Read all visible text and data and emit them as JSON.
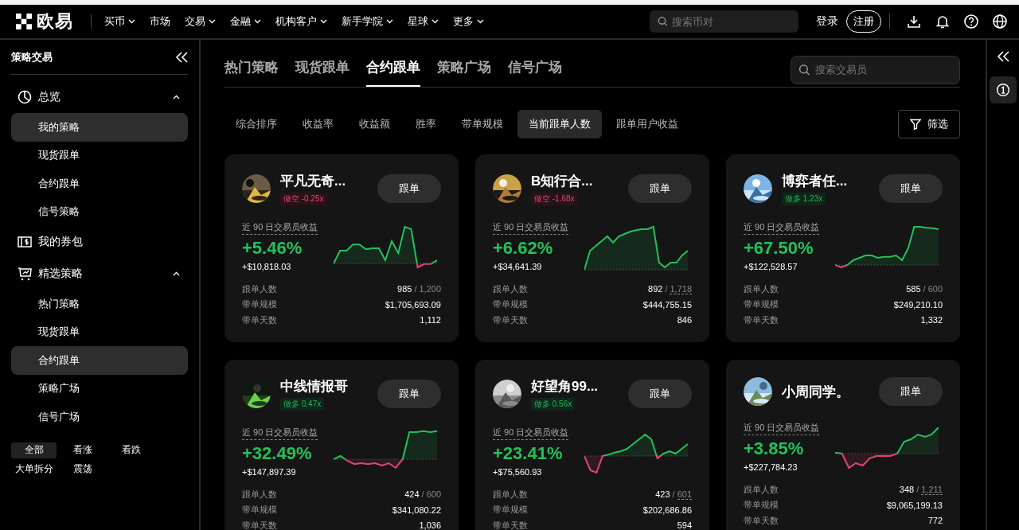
{
  "header": {
    "logo": "欧易",
    "menu": [
      {
        "label": "买币",
        "dropdown": true
      },
      {
        "label": "市场",
        "dropdown": false
      },
      {
        "label": "交易",
        "dropdown": true
      },
      {
        "label": "金融",
        "dropdown": true
      },
      {
        "label": "机构客户",
        "dropdown": true
      },
      {
        "label": "新手学院",
        "dropdown": true
      },
      {
        "label": "星球",
        "dropdown": true
      },
      {
        "label": "更多",
        "dropdown": true
      }
    ],
    "search": {
      "placeholder": "搜索币对"
    },
    "login": "登录",
    "register": "注册"
  },
  "sidebar": {
    "title": "策略交易",
    "groups": [
      {
        "label": "总览",
        "expanded": true,
        "children": [
          {
            "label": "我的策略",
            "selected": true
          },
          {
            "label": "现货跟单",
            "selected": false
          },
          {
            "label": "合约跟单",
            "selected": false
          },
          {
            "label": "信号策略",
            "selected": false
          }
        ]
      },
      {
        "label": "我的券包"
      },
      {
        "label": "精选策略",
        "expanded": true,
        "children": [
          {
            "label": "热门策略",
            "selected": false
          },
          {
            "label": "现货跟单",
            "selected": false
          },
          {
            "label": "合约跟单",
            "selected": true
          },
          {
            "label": "策略广场",
            "selected": false
          },
          {
            "label": "信号广场",
            "selected": false
          }
        ]
      }
    ],
    "filters": [
      {
        "label": "全部",
        "selected": true
      },
      {
        "label": "看涨",
        "selected": false
      },
      {
        "label": "看跌",
        "selected": false
      },
      {
        "label": "大单拆分",
        "selected": false
      },
      {
        "label": "震荡",
        "selected": false
      }
    ]
  },
  "main": {
    "tabs": [
      {
        "label": "热门策略",
        "selected": false
      },
      {
        "label": "现货跟单",
        "selected": false
      },
      {
        "label": "合约跟单",
        "selected": true
      },
      {
        "label": "策略广场",
        "selected": false
      },
      {
        "label": "信号广场",
        "selected": false
      }
    ],
    "search": {
      "placeholder": "搜索交易员"
    },
    "sort_options": [
      {
        "label": "综合排序",
        "selected": false
      },
      {
        "label": "收益率",
        "selected": false
      },
      {
        "label": "收益额",
        "selected": false
      },
      {
        "label": "胜率",
        "selected": false
      },
      {
        "label": "带单规模",
        "selected": false
      },
      {
        "label": "当前跟单人数",
        "selected": true
      },
      {
        "label": "跟单用户收益",
        "selected": false
      }
    ],
    "filter_button": "筛选",
    "cards": [
      {
        "name": "平凡无奇...",
        "tag": {
          "kind": "short",
          "text": "做空 -0.25x"
        },
        "button": "跟单",
        "metric_label": "近 90 日交易员收益",
        "roi": "+5.46%",
        "pnl": "+$10,818.03",
        "stats": [
          {
            "label": "跟单人数",
            "value": "985",
            "separator": "/",
            "max": "1,200",
            "max_underlined": false
          },
          {
            "label": "带单规模",
            "value": "$1,705,693.09"
          },
          {
            "label": "带单天数",
            "value": "1,112"
          }
        ]
      },
      {
        "name": "B知行合...",
        "tag": {
          "kind": "short",
          "text": "做空 -1.68x"
        },
        "button": "跟单",
        "metric_label": "近 90 日交易员收益",
        "roi": "+6.62%",
        "pnl": "+$34,641.39",
        "stats": [
          {
            "label": "跟单人数",
            "value": "892",
            "separator": "/",
            "max": "1,718",
            "max_underlined": true
          },
          {
            "label": "带单规模",
            "value": "$444,755.15"
          },
          {
            "label": "带单天数",
            "value": "846"
          }
        ]
      },
      {
        "name": "博弈者任...",
        "tag": {
          "kind": "long",
          "text": "做多 1.23x"
        },
        "button": "跟单",
        "metric_label": "近 90 日交易员收益",
        "roi": "+67.50%",
        "pnl": "+$122,528.57",
        "stats": [
          {
            "label": "跟单人数",
            "value": "585",
            "separator": "/",
            "max": "600",
            "max_underlined": false
          },
          {
            "label": "带单规模",
            "value": "$249,210.10"
          },
          {
            "label": "带单天数",
            "value": "1,332"
          }
        ]
      },
      {
        "name": "中线情报哥",
        "tag": {
          "kind": "long",
          "text": "做多 0.47x"
        },
        "button": "跟单",
        "metric_label": "近 90 日交易员收益",
        "roi": "+32.49%",
        "pnl": "+$147,897.39",
        "stats": [
          {
            "label": "跟单人数",
            "value": "424",
            "separator": "/",
            "max": "600",
            "max_underlined": false
          },
          {
            "label": "带单规模",
            "value": "$341,080.22"
          },
          {
            "label": "带单天数",
            "value": "1,036"
          }
        ]
      },
      {
        "name": "好望角99...",
        "tag": {
          "kind": "long",
          "text": "做多 0.56x"
        },
        "button": "跟单",
        "metric_label": "近 90 日交易员收益",
        "roi": "+23.41%",
        "pnl": "+$75,560.93",
        "stats": [
          {
            "label": "跟单人数",
            "value": "423",
            "separator": "/",
            "max": "601",
            "max_underlined": true
          },
          {
            "label": "带单规模",
            "value": "$202,686.86"
          },
          {
            "label": "带单天数",
            "value": "594"
          }
        ]
      },
      {
        "name": "小周同学。",
        "button": "跟单",
        "metric_label": "近 90 日交易员收益",
        "roi": "+3.85%",
        "pnl": "+$227,784.23",
        "stats": [
          {
            "label": "跟单人数",
            "value": "348",
            "separator": "/",
            "max": "1,211",
            "max_underlined": true
          },
          {
            "label": "带单规模",
            "value": "$9,065,199.13"
          },
          {
            "label": "带单天数",
            "value": "772"
          }
        ]
      }
    ]
  }
}
